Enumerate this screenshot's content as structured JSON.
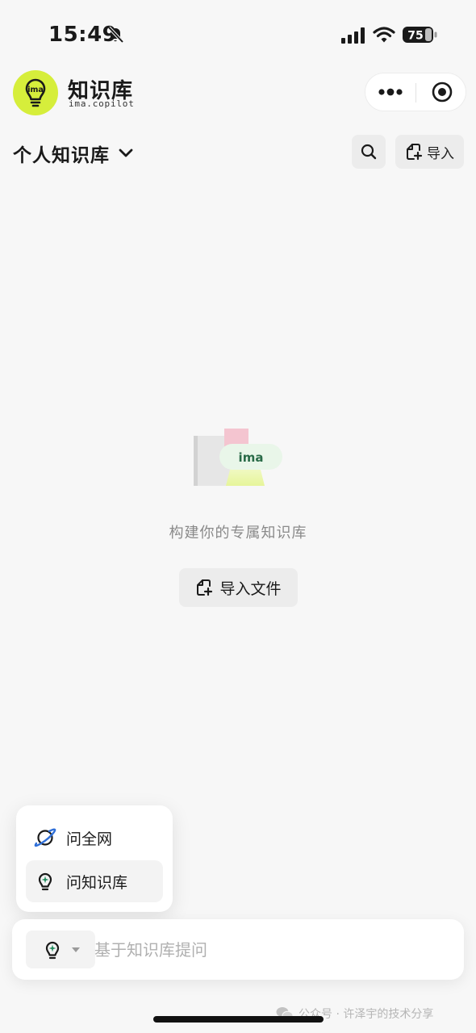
{
  "status_bar": {
    "time": "15:49",
    "battery": "75"
  },
  "header": {
    "app_title": "知识库",
    "app_subtitle": "ima.copilot",
    "logo_text": "ima"
  },
  "kb": {
    "name": "个人知识库",
    "import_label": "导入"
  },
  "empty_state": {
    "illustration_text": "ima",
    "text": "构建你的专属知识库",
    "import_file_label": "导入文件"
  },
  "popup": {
    "items": [
      {
        "label": "问全网",
        "icon": "planet-icon"
      },
      {
        "label": "问知识库",
        "icon": "bulb-icon",
        "selected": true
      }
    ]
  },
  "input": {
    "placeholder": "基于知识库提问"
  },
  "footer": {
    "watermark": "公众号 · 许泽宇的技术分享"
  },
  "colors": {
    "brand_lime": "#d6ee3b",
    "icon_green": "#1f8a5b",
    "planet_blue": "#2f6fd8",
    "background": "#f7f7f7"
  }
}
